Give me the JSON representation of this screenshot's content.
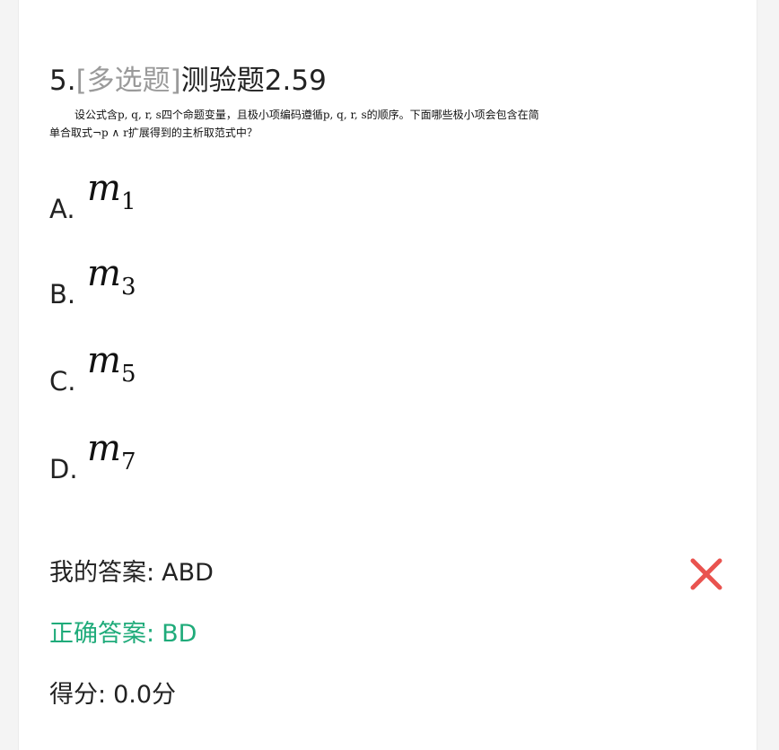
{
  "question": {
    "number": "5.",
    "type": "[多选题]",
    "title": "测验题2.59",
    "body_line1": "设公式含p, q, r, s四个命题变量，且极小项编码遵循p, q, r, s的顺序。下面哪些极小项会包含在简",
    "body_line2": "单合取式¬p ∧ r扩展得到的主析取范式中？"
  },
  "options": [
    {
      "letter": "A.",
      "base": "m",
      "sub": "1"
    },
    {
      "letter": "B.",
      "base": "m",
      "sub": "3"
    },
    {
      "letter": "C.",
      "base": "m",
      "sub": "5"
    },
    {
      "letter": "D.",
      "base": "m",
      "sub": "7"
    }
  ],
  "result": {
    "my_answer_label": "我的答案:",
    "my_answer_value": "ABD",
    "correct_answer_label": "正确答案:",
    "correct_answer_value": "BD",
    "score_label": "得分:",
    "score_value": "0.0分",
    "status_icon": "wrong-x-icon",
    "wrong_color": "#e9534f",
    "correct_color": "#1fab7a"
  }
}
